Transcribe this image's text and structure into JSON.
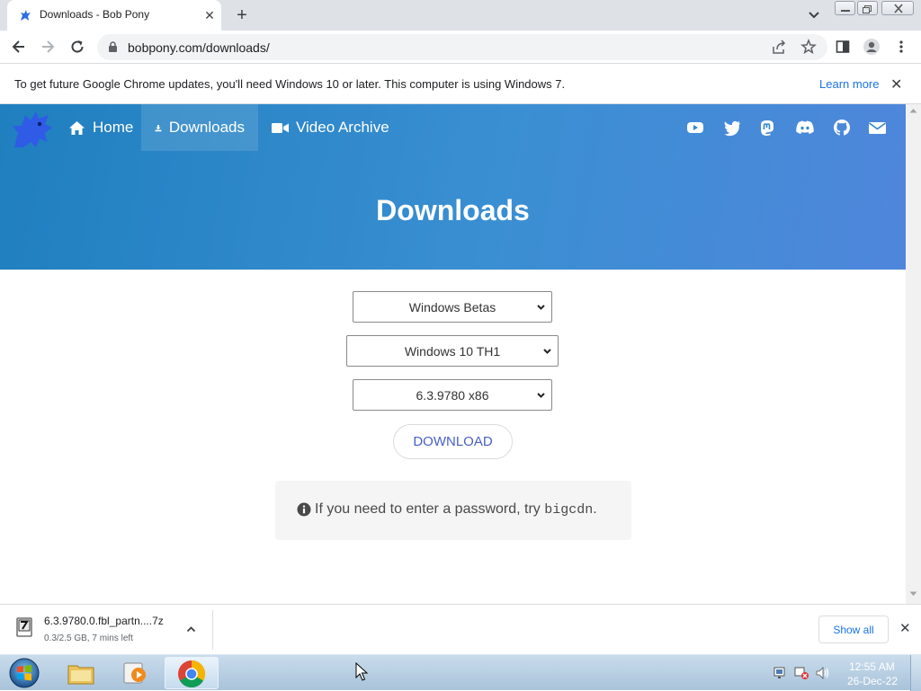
{
  "browser": {
    "tab_title": "Downloads - Bob Pony",
    "tab_close": "✕",
    "new_tab": "+",
    "url": "bobpony.com/downloads/"
  },
  "infobar": {
    "message": "To get future Google Chrome updates, you'll need Windows 10 or later. This computer is using Windows 7.",
    "learn_more": "Learn more",
    "close": "✕"
  },
  "site": {
    "nav": [
      {
        "label": "Home",
        "icon": "home-icon"
      },
      {
        "label": "Downloads",
        "icon": "download-icon"
      },
      {
        "label": "Video Archive",
        "icon": "video-camera-icon"
      }
    ],
    "social_icons": [
      "youtube-icon",
      "twitter-icon",
      "mastodon-icon",
      "discord-icon",
      "github-icon",
      "email-icon"
    ],
    "title": "Downloads",
    "selects": {
      "category": "Windows Betas",
      "build": "Windows 10 TH1",
      "version": "6.3.9780 x86"
    },
    "download_button": "DOWNLOAD",
    "notice_prefix": "If you need to enter a password, try ",
    "notice_code": "bigcdn",
    "notice_suffix": "."
  },
  "download_shelf": {
    "file_name": "6.3.9780.0.fbl_partn....7z",
    "status": "0.3/2.5 GB, 7 mins left",
    "show_all": "Show all",
    "close": "✕"
  },
  "taskbar": {
    "time": "12:55 AM",
    "date": "26-Dec-22"
  },
  "colors": {
    "hero_start": "#1f7fbf",
    "hero_end": "#4f86dc",
    "link_blue": "#1a73e8",
    "button_text": "#485fc7"
  }
}
